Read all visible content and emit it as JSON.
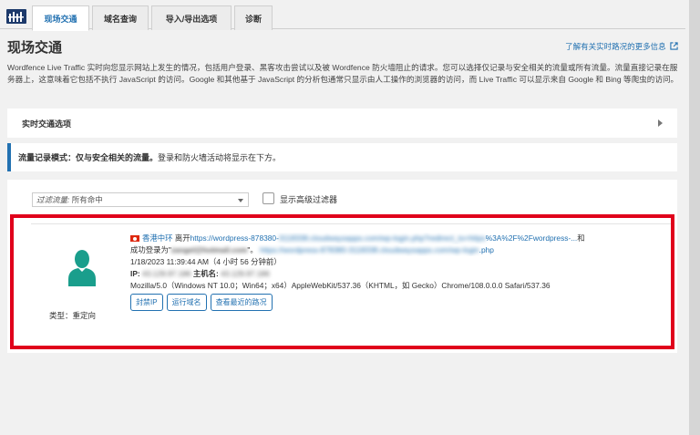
{
  "tabs": [
    "现场交通",
    "域名查询",
    "导入/导出选项",
    "诊断"
  ],
  "page_title": "现场交通",
  "learn_more": "了解有关实时路况的更多信息",
  "description": "Wordfence Live Traffic 实时向您显示网站上发生的情况，包括用户登录、黑客攻击尝试以及被 Wordfence 防火墙阻止的请求。您可以选择仅记录与安全相关的流量或所有流量。流量直接记录在服务器上，这意味着它包括不执行 JavaScript 的访问。Google 和其他基于 JavaScript 的分析包通常只显示由人工操作的浏览器的访问，而 Live Traffic 可以显示来自 Google 和 Bing 等爬虫的访问。",
  "options_label": "实时交通选项",
  "mode": {
    "label": "流量记录模式：仅与安全相关的流量。",
    "text": "登录和防火墙活动将显示在下方。"
  },
  "filter": {
    "label": "过滤流量:",
    "value": "所有命中"
  },
  "advanced_filter_label": "显示高级过滤器",
  "entry": {
    "location": "香港中环",
    "left_text": "离开",
    "url1_visible": "https://wordpress-878380-",
    "url1_blurred": "3118338.cloudwaysapps.com/wp-login.php?redirect_to=https",
    "url1_tail": "%3A%2F%2Fwordpress-...",
    "and": "和",
    "login_as": "成功登录为\"",
    "user_blurred": "zangel@hotmail.com",
    "login_close": "\"。",
    "url2_blurred": "https://wordpress-878380-3118338.cloudwaysapps.com/wp-login",
    "url2_tail": ".php",
    "timestamp": "1/18/2023 11:39:44 AM（4 小时 56 分钟前）",
    "ip_label": "IP:",
    "ip_blurred": "43.129.97.186",
    "host_label": "主机名:",
    "host_blurred": "43.129.97.186",
    "user_agent": "Mozilla/5.0（Windows NT 10.0；Win64；x64）AppleWebKit/537.36（KHTML，如 Gecko）Chrome/108.0.0.0 Safari/537.36",
    "type_label": "类型：重定向",
    "buttons": [
      "封禁IP",
      "运行域名",
      "查看最近的路况"
    ]
  },
  "colors": {
    "accent": "#2271b1",
    "avatar": "#1a9e8c",
    "highlight_border": "#e0001b"
  }
}
